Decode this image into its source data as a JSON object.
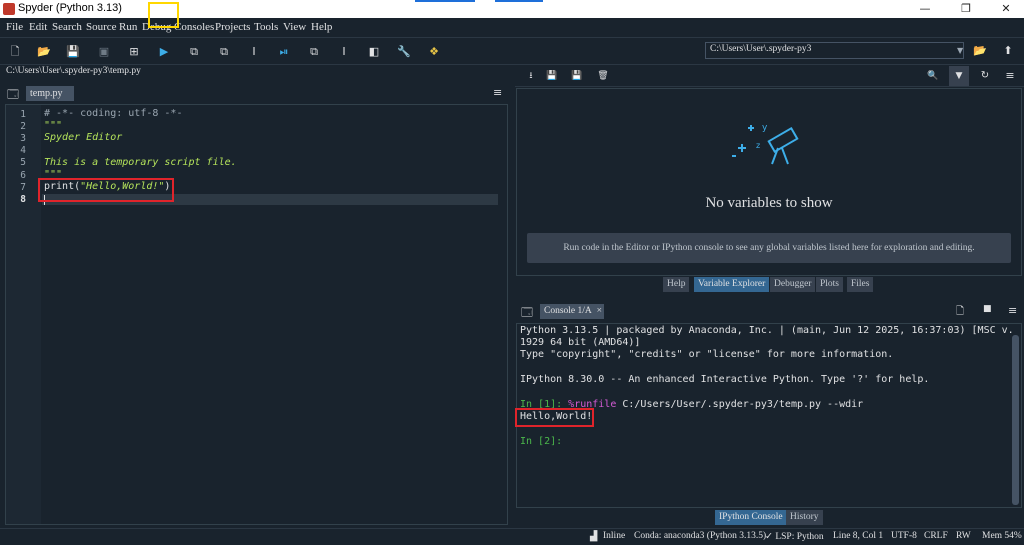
{
  "window": {
    "title": "Spyder (Python 3.13)",
    "minimize": "—",
    "maximize": "❐",
    "close": "✕"
  },
  "menu": [
    "File",
    "Edit",
    "Search",
    "Source",
    "Run",
    "Debug",
    "Consoles",
    "Projects",
    "Tools",
    "View",
    "Help"
  ],
  "toolbar": {
    "working_dir": "C:\\Users\\User\\.spyder-py3"
  },
  "editor": {
    "path": "C:\\Users\\User\\.spyder-py3\\temp.py",
    "tab_label": "temp.py",
    "tab_close": "×",
    "line_numbers": [
      "1",
      "2",
      "3",
      "4",
      "5",
      "6",
      "7",
      "8"
    ],
    "lines": {
      "l1": "# -*- coding: utf-8 -*-",
      "l2": "\"\"\"",
      "l3": "Spyder Editor",
      "l5": "This is a temporary script file.",
      "l6": "\"\"\"",
      "l7_fn": "print(",
      "l7_str": "\"Hello,World!\"",
      "l7_end": ")"
    },
    "current_line": 8
  },
  "variable_explorer": {
    "empty_message": "No variables to show",
    "hint": "Run code in the Editor or IPython console to see any global variables listed here for exploration and editing.",
    "tabs": [
      "Help",
      "Variable Explorer",
      "Debugger",
      "Plots",
      "Files"
    ],
    "active_tab": "Variable Explorer"
  },
  "console": {
    "tab_label": "Console 1/A",
    "tab_close": "×",
    "banner1": "Python 3.13.5 | packaged by Anaconda, Inc. | (main, Jun 12 2025, 16:37:03) [MSC v.",
    "banner2": "1929 64 bit (AMD64)]",
    "banner3": "Type \"copyright\", \"credits\" or \"license\" for more information.",
    "banner4": "IPython 8.30.0 -- An enhanced Interactive Python. Type '?' for help.",
    "prompt1": "In [1]: ",
    "magic": "%runfile",
    "cmd": " C:/Users/User/.spyder-py3/temp.py --wdir",
    "output": "Hello,World!",
    "prompt2": "In [2]:",
    "tabs": [
      "IPython Console",
      "History"
    ],
    "active_tab": "IPython Console"
  },
  "statusbar": {
    "inline": "Inline",
    "conda": "Conda: anaconda3 (Python 3.13.5)",
    "lsp": "✓ LSP: Python",
    "position": "Line 8, Col 1",
    "encoding": "UTF-8",
    "eol": "CRLF",
    "mode": "RW",
    "mem": "Mem 54%"
  },
  "colors": {
    "background": "#19232d",
    "highlight_run": "#ffd700",
    "highlight_output": "#e0242b",
    "accent": "#346792"
  }
}
